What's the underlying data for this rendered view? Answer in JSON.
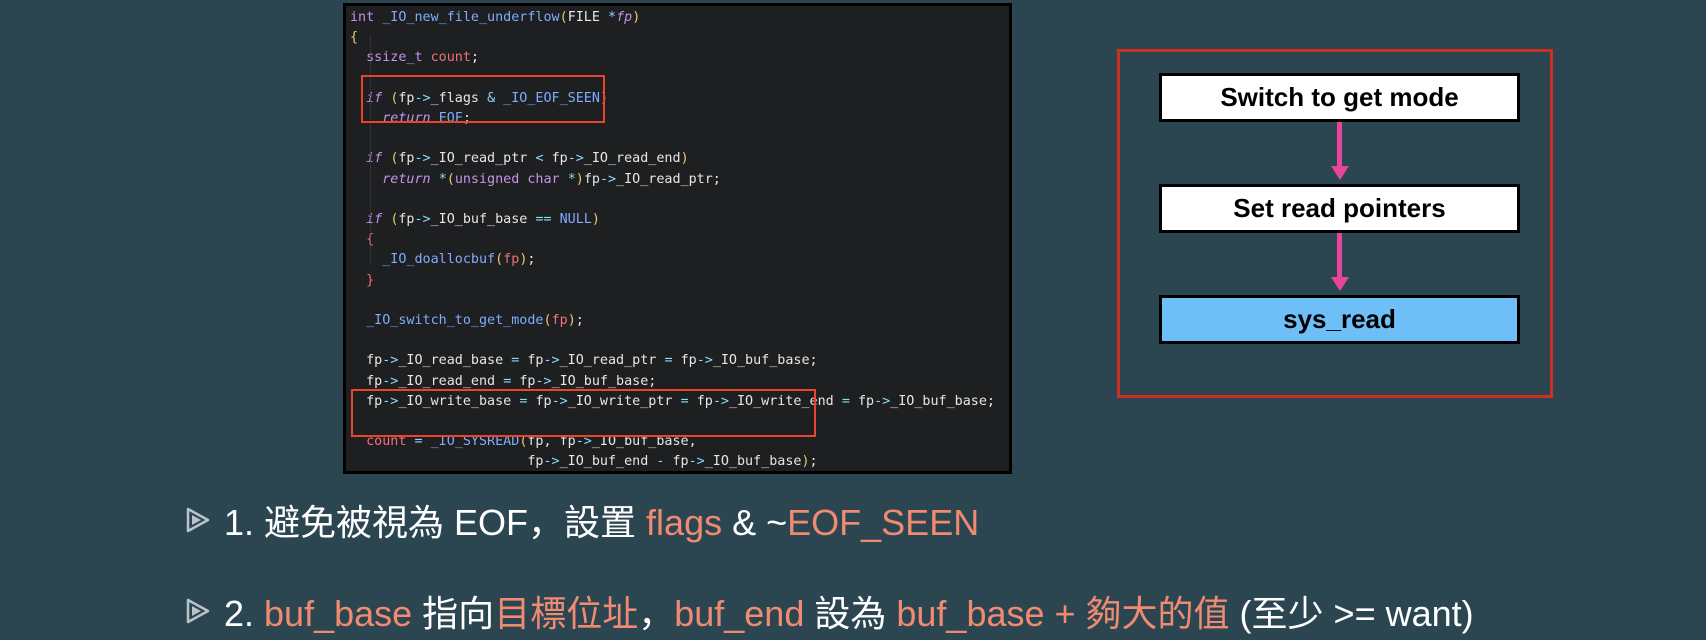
{
  "code": {
    "lines": [
      [
        [
          "ty",
          "int "
        ],
        [
          "fn",
          "_IO_new_file_underflow"
        ],
        [
          "par",
          "("
        ],
        [
          "pl",
          "FILE "
        ],
        [
          "op",
          "*"
        ],
        [
          "kw",
          "fp"
        ],
        [
          "par",
          ")"
        ]
      ],
      [
        [
          "par",
          "{"
        ]
      ],
      [
        [
          "pl",
          "  "
        ],
        [
          "ty",
          "ssize_t "
        ],
        [
          "var",
          "count"
        ],
        [
          "pl",
          ";"
        ]
      ],
      [],
      [
        [
          "pl",
          "  "
        ],
        [
          "kw",
          "if "
        ],
        [
          "par",
          "("
        ],
        [
          "pl",
          "fp"
        ],
        [
          "op",
          "->"
        ],
        [
          "pl",
          "_flags "
        ],
        [
          "op",
          "& "
        ],
        [
          "mac",
          "_IO_EOF_SEEN"
        ],
        [
          "par",
          ")"
        ]
      ],
      [
        [
          "pl",
          "    "
        ],
        [
          "kw",
          "return "
        ],
        [
          "mac",
          "EOF"
        ],
        [
          "pl",
          ";"
        ]
      ],
      [],
      [
        [
          "pl",
          "  "
        ],
        [
          "kw",
          "if "
        ],
        [
          "par",
          "("
        ],
        [
          "pl",
          "fp"
        ],
        [
          "op",
          "->"
        ],
        [
          "pl",
          "_IO_read_ptr "
        ],
        [
          "op",
          "< "
        ],
        [
          "pl",
          "fp"
        ],
        [
          "op",
          "->"
        ],
        [
          "pl",
          "_IO_read_end"
        ],
        [
          "par",
          ")"
        ]
      ],
      [
        [
          "pl",
          "    "
        ],
        [
          "kw",
          "return "
        ],
        [
          "op",
          "*"
        ],
        [
          "par",
          "("
        ],
        [
          "ty",
          "unsigned char "
        ],
        [
          "op",
          "*"
        ],
        [
          "par",
          ")"
        ],
        [
          "pl",
          "fp"
        ],
        [
          "op",
          "->"
        ],
        [
          "pl",
          "_IO_read_ptr;"
        ]
      ],
      [],
      [
        [
          "pl",
          "  "
        ],
        [
          "kw",
          "if "
        ],
        [
          "par",
          "("
        ],
        [
          "pl",
          "fp"
        ],
        [
          "op",
          "->"
        ],
        [
          "pl",
          "_IO_buf_base "
        ],
        [
          "op",
          "== "
        ],
        [
          "mac",
          "NULL"
        ],
        [
          "par",
          ")"
        ]
      ],
      [
        [
          "pl",
          "  "
        ],
        [
          "var",
          "{"
        ]
      ],
      [
        [
          "pl",
          "    "
        ],
        [
          "fn",
          "_IO_doallocbuf"
        ],
        [
          "par",
          "("
        ],
        [
          "var",
          "fp"
        ],
        [
          "par",
          ")"
        ],
        [
          "pl",
          ";"
        ]
      ],
      [
        [
          "pl",
          "  "
        ],
        [
          "var",
          "}"
        ]
      ],
      [],
      [
        [
          "pl",
          "  "
        ],
        [
          "fn",
          "_IO_switch_to_get_mode"
        ],
        [
          "par",
          "("
        ],
        [
          "var",
          "fp"
        ],
        [
          "par",
          ")"
        ],
        [
          "pl",
          ";"
        ]
      ],
      [],
      [
        [
          "pl",
          "  fp"
        ],
        [
          "op",
          "->"
        ],
        [
          "pl",
          "_IO_read_base "
        ],
        [
          "op",
          "= "
        ],
        [
          "pl",
          "fp"
        ],
        [
          "op",
          "->"
        ],
        [
          "pl",
          "_IO_read_ptr "
        ],
        [
          "op",
          "= "
        ],
        [
          "pl",
          "fp"
        ],
        [
          "op",
          "->"
        ],
        [
          "pl",
          "_IO_buf_base;"
        ]
      ],
      [
        [
          "pl",
          "  fp"
        ],
        [
          "op",
          "->"
        ],
        [
          "pl",
          "_IO_read_end "
        ],
        [
          "op",
          "= "
        ],
        [
          "pl",
          "fp"
        ],
        [
          "op",
          "->"
        ],
        [
          "pl",
          "_IO_buf_base;"
        ]
      ],
      [
        [
          "pl",
          "  fp"
        ],
        [
          "op",
          "->"
        ],
        [
          "pl",
          "_IO_write_base "
        ],
        [
          "op",
          "= "
        ],
        [
          "pl",
          "fp"
        ],
        [
          "op",
          "->"
        ],
        [
          "pl",
          "_IO_write_ptr "
        ],
        [
          "op",
          "= "
        ],
        [
          "pl",
          "fp"
        ],
        [
          "op",
          "->"
        ],
        [
          "pl",
          "_IO_write_end "
        ],
        [
          "op",
          "= "
        ],
        [
          "pl",
          "fp"
        ],
        [
          "op",
          "->"
        ],
        [
          "pl",
          "_IO_buf_base;"
        ]
      ],
      [],
      [
        [
          "pl",
          "  "
        ],
        [
          "var",
          "count "
        ],
        [
          "op",
          "= "
        ],
        [
          "fn",
          "_IO_SYSREAD"
        ],
        [
          "par",
          "("
        ],
        [
          "pl",
          "fp, fp"
        ],
        [
          "op",
          "->"
        ],
        [
          "pl",
          "_IO_buf_base,"
        ]
      ],
      [
        [
          "pl",
          "                      fp"
        ],
        [
          "op",
          "->"
        ],
        [
          "pl",
          "_IO_buf_end "
        ],
        [
          "op",
          "- "
        ],
        [
          "pl",
          "fp"
        ],
        [
          "op",
          "->"
        ],
        [
          "pl",
          "_IO_buf_base"
        ],
        [
          "par",
          ")"
        ],
        [
          "pl",
          ";"
        ]
      ]
    ]
  },
  "flow": {
    "boxes": [
      {
        "label": "Switch to get mode"
      },
      {
        "label": "Set read pointers"
      },
      {
        "label": "sys_read"
      }
    ]
  },
  "bullets": [
    {
      "segments": [
        {
          "text": "1. 避免被視為 EOF，設置 ",
          "hl": false
        },
        {
          "text": "flags",
          "hl": true
        },
        {
          "text": " & ~",
          "hl": false
        },
        {
          "text": "EOF_SEEN",
          "hl": true
        }
      ]
    },
    {
      "segments": [
        {
          "text": "2. ",
          "hl": false
        },
        {
          "text": "buf_base",
          "hl": true
        },
        {
          "text": " 指向",
          "hl": false
        },
        {
          "text": "目標位址",
          "hl": true
        },
        {
          "text": "，",
          "hl": false
        },
        {
          "text": "buf_end",
          "hl": true
        },
        {
          "text": " 設為 ",
          "hl": false
        },
        {
          "text": "buf_base + 夠大的值",
          "hl": true
        },
        {
          "text": " (至少 >= want)",
          "hl": false
        }
      ]
    }
  ],
  "colors": {
    "background": "#2c4651",
    "highlight_text": "#f08a70",
    "frame_red": "#cc2f24",
    "code_box_red": "#e8442e",
    "arrow_pink": "#e8459a",
    "sysread_blue": "#6ebef7"
  },
  "icons": {
    "bullet": "play-triangle-icon"
  }
}
